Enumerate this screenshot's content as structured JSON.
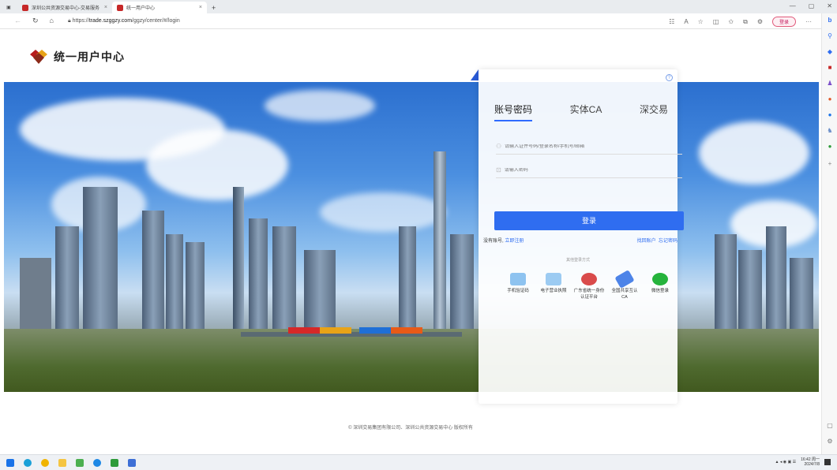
{
  "browser": {
    "tabs": [
      {
        "label": "深圳公共资源交易中心-交易服务",
        "active": false
      },
      {
        "label": "统一用户中心",
        "active": true
      }
    ],
    "url_prefix": "https://",
    "url_host": "trade.szggzy.com",
    "url_path": "/ggzy/center/#/login",
    "login_pill": "登录"
  },
  "header": {
    "title": "统一用户中心"
  },
  "login": {
    "tabs": [
      "账号密码",
      "实体CA",
      "深交易"
    ],
    "username_placeholder": "请输入证件号码/登录名称/手机号/邮箱",
    "password_placeholder": "请输入密码",
    "submit_label": "登录",
    "no_account": "没有账号,",
    "register_link": "立即注册",
    "find_account": "找回账户",
    "forgot_password": "忘记密码",
    "other_methods": "其他登录方式",
    "methods": [
      {
        "label": "手机验证码",
        "icon": "phone-icon",
        "color": "#8ec3f0"
      },
      {
        "label": "电子营业执照",
        "icon": "license-icon",
        "color": "#9ccbf2"
      },
      {
        "label": "广东省统一身份认证平台",
        "icon": "id-icon",
        "color": "#d94b4b"
      },
      {
        "label": "全国共享互认CA",
        "icon": "usb-key-icon",
        "color": "#4d84e8"
      },
      {
        "label": "微信登录",
        "icon": "wechat-icon",
        "color": "#25b33c"
      }
    ]
  },
  "footer": {
    "copyright": "© 深圳交易集团有限公司、深圳公共资源交易中心 版权所有"
  },
  "taskbar": {
    "time": "16:42 周一",
    "date": "2024/7/8"
  }
}
